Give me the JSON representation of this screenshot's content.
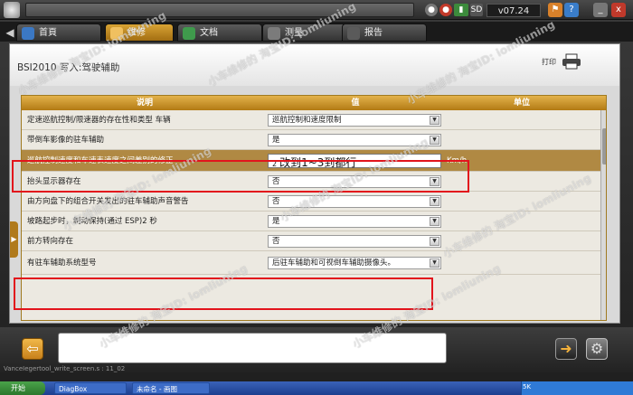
{
  "topbar": {
    "version": "v07.24",
    "icon_names": [
      "peugeot-logo",
      "status-icon",
      "record-icon",
      "battery-icon",
      "sd-icon",
      "language-icon",
      "help-icon",
      "minimize-icon",
      "close-icon"
    ],
    "sd_label": "SD",
    "minimize_label": "_",
    "close_label": "x"
  },
  "tabs": [
    {
      "label": "首頁"
    },
    {
      "label": "维修"
    },
    {
      "label": "文档"
    },
    {
      "label": "测量"
    },
    {
      "label": "报告"
    }
  ],
  "page": {
    "title": "BSI2010 写入:驾驶辅助",
    "print_label": "打印"
  },
  "table": {
    "headers": [
      "说明",
      "值",
      "单位"
    ],
    "rows": [
      {
        "label": "定速巡航控制/限速器的存在性和类型 车辆",
        "value": "巡航控制和速度限制",
        "unit": ""
      },
      {
        "label": "带倒车影像的驻车辅助",
        "value": "是",
        "unit": ""
      },
      {
        "label": "巡航控制速度和车速表速度之间差别的修正",
        "value": "2",
        "annotation": "改到1~3到都行",
        "unit": "Km/h"
      },
      {
        "label": "抬头显示器存在",
        "value": "否",
        "unit": ""
      },
      {
        "label": "由方向盘下的组合开关发出的驻车辅助声音警告",
        "value": "否",
        "unit": ""
      },
      {
        "label": "坡路起步时，制动保持(通过 ESP)2 秒",
        "value": "是",
        "unit": ""
      },
      {
        "label": "前方转向存在",
        "value": "否",
        "unit": ""
      },
      {
        "label": "有驻车辅助系统型号",
        "value": "后驻车辅助和可视倒车辅助摄像头。",
        "unit": ""
      }
    ]
  },
  "bottom": {
    "back_label": "⇦",
    "next_label": "➜",
    "settings_label": "⚙",
    "status_line": "VanceIegertool_write_screen.s : 11_02"
  },
  "taskbar": {
    "start_label": "开始",
    "tasks": [
      "DiagBox",
      "未命名 - 画图"
    ],
    "ime": "5K"
  },
  "watermark": "小车维修的 淘宝ID: iomliuning"
}
